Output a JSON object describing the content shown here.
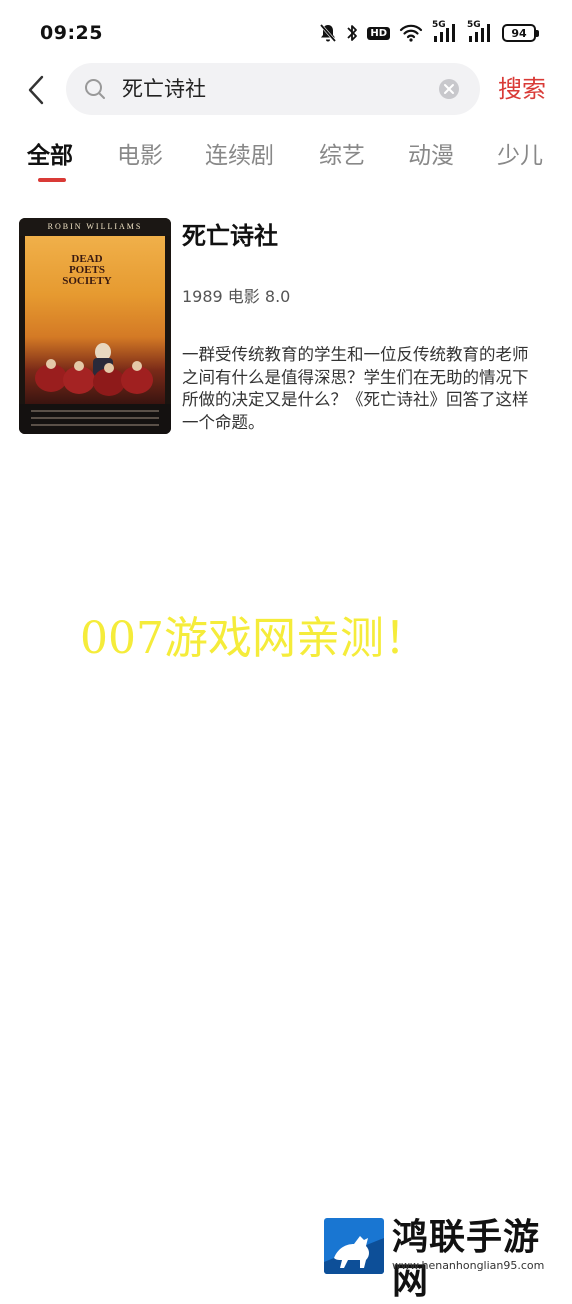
{
  "status_bar": {
    "time": "09:25",
    "network_labels": [
      "5G",
      "5G"
    ],
    "battery": "94"
  },
  "search": {
    "query": "死亡诗社",
    "button_label": "搜索"
  },
  "tabs": [
    {
      "label": "全部",
      "active": true
    },
    {
      "label": "电影",
      "active": false
    },
    {
      "label": "连续剧",
      "active": false
    },
    {
      "label": "综艺",
      "active": false
    },
    {
      "label": "动漫",
      "active": false
    },
    {
      "label": "少儿",
      "active": false
    }
  ],
  "result": {
    "title": "死亡诗社",
    "meta": "1989 电影 8.0",
    "description": "一群受传统教育的学生和一位反传统教育的老师之间有什么是值得深思？学生们在无助的情况下所做的决定又是什么？《死亡诗社》回答了这样一个命题。",
    "poster": {
      "top_text": "ROBIN WILLIAMS",
      "title_lines": [
        "DEAD",
        "POETS",
        "SOCIETY"
      ]
    }
  },
  "watermark": {
    "overlay_text": "007游戏网亲测！",
    "brand": "鸿联手游网",
    "url": "www.henanhonglian95.com"
  },
  "colors": {
    "accent": "#d93a36",
    "search_bg": "#f2f2f4",
    "overlay_text": "#f5ec3a",
    "logo_blue": "#1976d2"
  }
}
